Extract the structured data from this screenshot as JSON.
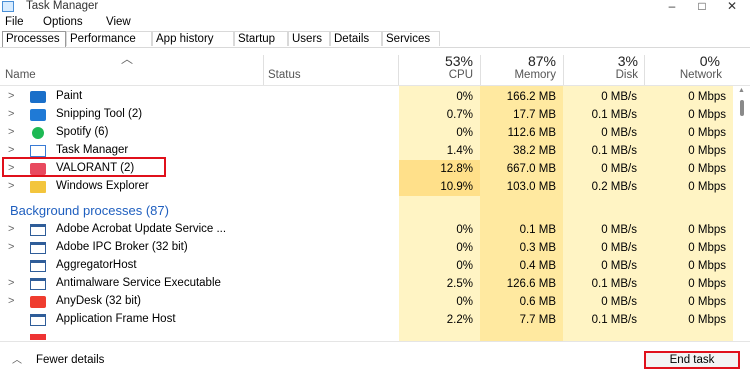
{
  "window": {
    "title": "Task Manager",
    "minimize": "–",
    "maximize": "□",
    "close": "✕"
  },
  "menu": [
    "File",
    "Options",
    "View"
  ],
  "tabs": [
    "Processes",
    "Performance",
    "App history",
    "Startup",
    "Users",
    "Details",
    "Services"
  ],
  "columns": {
    "name": "Name",
    "status": "Status",
    "cpu": {
      "pct": "53%",
      "label": "CPU"
    },
    "memory": {
      "pct": "87%",
      "label": "Memory"
    },
    "disk": {
      "pct": "3%",
      "label": "Disk"
    },
    "network": {
      "pct": "0%",
      "label": "Network"
    }
  },
  "apps": [
    {
      "name": "Paint",
      "icon": "paint-icon",
      "cpu": "0%",
      "mem": "166.2 MB",
      "disk": "0 MB/s",
      "net": "0 Mbps"
    },
    {
      "name": "Snipping Tool (2)",
      "icon": "snipping-tool-icon",
      "cpu": "0.7%",
      "mem": "17.7 MB",
      "disk": "0.1 MB/s",
      "net": "0 Mbps"
    },
    {
      "name": "Spotify (6)",
      "icon": "spotify-icon",
      "cpu": "0%",
      "mem": "112.6 MB",
      "disk": "0 MB/s",
      "net": "0 Mbps"
    },
    {
      "name": "Task Manager",
      "icon": "task-manager-icon",
      "cpu": "1.4%",
      "mem": "38.2 MB",
      "disk": "0.1 MB/s",
      "net": "0 Mbps"
    },
    {
      "name": "VALORANT (2)",
      "icon": "valorant-icon",
      "cpu": "12.8%",
      "mem": "667.0 MB",
      "disk": "0 MB/s",
      "net": "0 Mbps"
    },
    {
      "name": "Windows Explorer",
      "icon": "folder-icon",
      "cpu": "10.9%",
      "mem": "103.0 MB",
      "disk": "0.2 MB/s",
      "net": "0 Mbps"
    }
  ],
  "background_header": "Background processes (87)",
  "background": [
    {
      "name": "Adobe Acrobat Update Service ...",
      "icon": "app-window-icon",
      "cpu": "0%",
      "mem": "0.1 MB",
      "disk": "0 MB/s",
      "net": "0 Mbps"
    },
    {
      "name": "Adobe IPC Broker (32 bit)",
      "icon": "app-window-icon",
      "cpu": "0%",
      "mem": "0.3 MB",
      "disk": "0 MB/s",
      "net": "0 Mbps"
    },
    {
      "name": "AggregatorHost",
      "icon": "app-window-icon",
      "cpu": "0%",
      "mem": "0.4 MB",
      "disk": "0 MB/s",
      "net": "0 Mbps"
    },
    {
      "name": "Antimalware Service Executable",
      "icon": "app-window-icon",
      "cpu": "2.5%",
      "mem": "126.6 MB",
      "disk": "0.1 MB/s",
      "net": "0 Mbps"
    },
    {
      "name": "AnyDesk (32 bit)",
      "icon": "anydesk-icon",
      "cpu": "0%",
      "mem": "0.6 MB",
      "disk": "0 MB/s",
      "net": "0 Mbps"
    },
    {
      "name": "Application Frame Host",
      "icon": "app-window-icon",
      "cpu": "2.2%",
      "mem": "7.7 MB",
      "disk": "0.1 MB/s",
      "net": "0 Mbps"
    }
  ],
  "footer": {
    "fewer_details": "Fewer details",
    "end_task": "End task"
  },
  "colors": {
    "heat_low": "#fff4c4",
    "heat_mid": "#ffe9a0",
    "group_blue": "#1f5fbf",
    "highlight_red": "#e0101b"
  }
}
